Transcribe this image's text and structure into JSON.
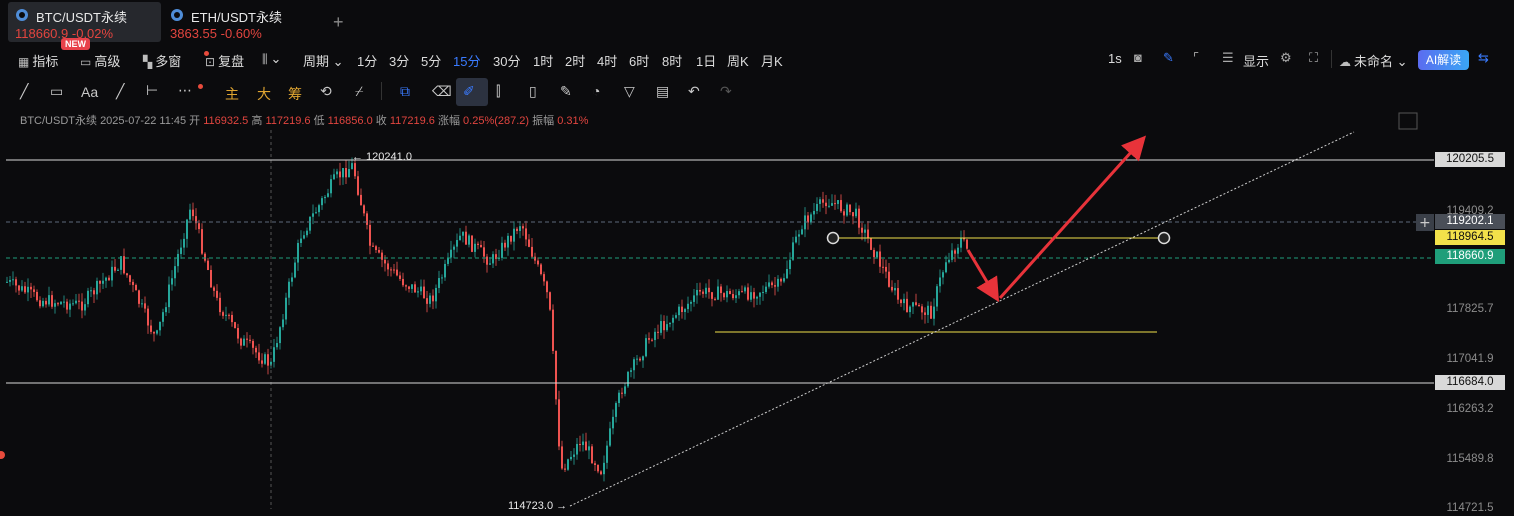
{
  "tabs": [
    {
      "name": "BTC/USDT永续",
      "price": "118660.9",
      "change": "-0.02%",
      "badge": "NEW"
    },
    {
      "name": "ETH/USDT永续",
      "price": "3863.55",
      "change": "-0.60%"
    }
  ],
  "toolbar": {
    "indicators": "指标",
    "advanced": "高级",
    "multi_window": "多窗",
    "replay": "复盘",
    "period": "周期",
    "intervals": [
      "1分",
      "3分",
      "5分",
      "15分",
      "30分",
      "1时",
      "2时",
      "4时",
      "6时",
      "8时",
      "1日",
      "周K",
      "月K"
    ],
    "selected_interval": "15分",
    "right_interval": "1s",
    "display": "显示",
    "layout_name": "未命名",
    "ai": "AI解读"
  },
  "drawing_tools": {
    "text_tool": "Aa",
    "main": "主",
    "big": "大",
    "chip": "筹"
  },
  "ohlc_info": {
    "symbol": "BTC/USDT永续",
    "time": "2025-07-22 11:45",
    "open_label": "开",
    "open": "116932.5",
    "high_label": "高",
    "high": "117219.6",
    "low_label": "低",
    "low": "116856.0",
    "close_label": "收",
    "close": "117219.6",
    "change_label": "涨幅",
    "change": "0.25%(287.2)",
    "amp_label": "振幅",
    "amp": "0.31%"
  },
  "price_axis": {
    "ticks": [
      "119409.2",
      "117825.7",
      "117041.9",
      "116263.2",
      "115489.8",
      "114721.5"
    ],
    "labels": [
      {
        "value": "120205.5",
        "bg": "#d9d9d9",
        "fg": "#111111"
      },
      {
        "value": "119202.1",
        "bg": "#4a4f58",
        "fg": "#ffffff"
      },
      {
        "value": "118964.5",
        "bg": "#f2e14a",
        "fg": "#111111"
      },
      {
        "value": "118660.9",
        "bg": "#1f9e7a",
        "fg": "#ffffff"
      },
      {
        "value": "116684.0",
        "bg": "#d9d9d9",
        "fg": "#111111"
      }
    ]
  },
  "annotations": {
    "high_marker": "← 120241.0",
    "low_marker": "114723.0 →"
  },
  "colors": {
    "up": "#26a69a",
    "down": "#ef5350",
    "accent": "#3a7bff",
    "arrow": "#e8333a"
  }
}
